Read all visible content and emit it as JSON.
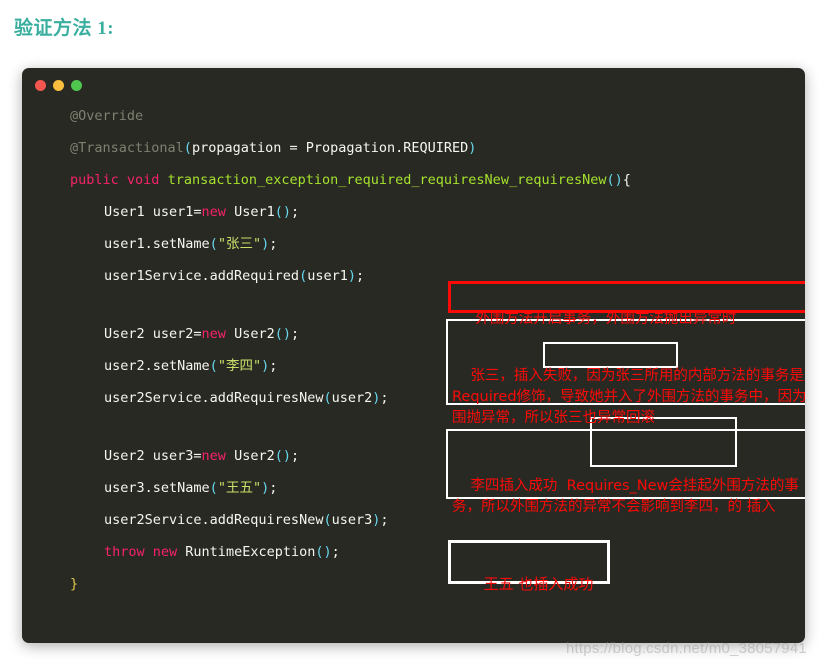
{
  "page": {
    "title": "验证方法 1:",
    "title_color": "#3aafa0",
    "background": "#ffffff"
  },
  "code_window": {
    "background": "#282923",
    "traffic_lights": [
      {
        "name": "close",
        "color": "#f4574f"
      },
      {
        "name": "minimize",
        "color": "#f9be3e"
      },
      {
        "name": "maximize",
        "color": "#4fc74f"
      }
    ],
    "lines": [
      {
        "indent": 0,
        "tokens": [
          {
            "t": "@Override",
            "c": "anno"
          }
        ]
      },
      {
        "indent": 0,
        "tokens": [
          {
            "t": "@Transactional",
            "c": "anno"
          },
          {
            "t": "(",
            "c": "punct"
          },
          {
            "t": "propagation",
            "c": "plain"
          },
          {
            "t": " = ",
            "c": "plain"
          },
          {
            "t": "Propagation.REQUIRED",
            "c": "plain"
          },
          {
            "t": ")",
            "c": "punct"
          }
        ]
      },
      {
        "indent": 0,
        "tokens": [
          {
            "t": "public",
            "c": "kw"
          },
          {
            "t": " ",
            "c": "plain"
          },
          {
            "t": "void",
            "c": "kw"
          },
          {
            "t": " ",
            "c": "plain"
          },
          {
            "t": "transaction_exception_required_requiresNew_requiresNew",
            "c": "fn"
          },
          {
            "t": "(",
            "c": "punct"
          },
          {
            "t": ")",
            "c": "punct"
          },
          {
            "t": "{",
            "c": "plain"
          }
        ]
      },
      {
        "indent": 1,
        "tokens": [
          {
            "t": "User1 user1=",
            "c": "plain"
          },
          {
            "t": "new",
            "c": "kw"
          },
          {
            "t": " User1",
            "c": "plain"
          },
          {
            "t": "(",
            "c": "punct"
          },
          {
            "t": ")",
            "c": "punct"
          },
          {
            "t": ";",
            "c": "plain"
          }
        ]
      },
      {
        "indent": 1,
        "tokens": [
          {
            "t": "user1.setName",
            "c": "plain"
          },
          {
            "t": "(",
            "c": "punct"
          },
          {
            "t": "\"张三\"",
            "c": "str"
          },
          {
            "t": ")",
            "c": "punct"
          },
          {
            "t": ";",
            "c": "plain"
          }
        ]
      },
      {
        "indent": 1,
        "tokens": [
          {
            "t": "user1Service.addRequired",
            "c": "plain"
          },
          {
            "t": "(",
            "c": "punct"
          },
          {
            "t": "user1",
            "c": "plain"
          },
          {
            "t": ")",
            "c": "punct"
          },
          {
            "t": ";",
            "c": "plain"
          }
        ]
      },
      {
        "indent": 1,
        "blank": true,
        "tokens": []
      },
      {
        "indent": 1,
        "tokens": [
          {
            "t": "User2 user2=",
            "c": "plain"
          },
          {
            "t": "new",
            "c": "kw"
          },
          {
            "t": " User2",
            "c": "plain"
          },
          {
            "t": "(",
            "c": "punct"
          },
          {
            "t": ")",
            "c": "punct"
          },
          {
            "t": ";",
            "c": "plain"
          }
        ]
      },
      {
        "indent": 1,
        "tokens": [
          {
            "t": "user2.setName",
            "c": "plain"
          },
          {
            "t": "(",
            "c": "punct"
          },
          {
            "t": "\"李四\"",
            "c": "str"
          },
          {
            "t": ")",
            "c": "punct"
          },
          {
            "t": ";",
            "c": "plain"
          }
        ]
      },
      {
        "indent": 1,
        "tokens": [
          {
            "t": "user2Service.addRequiresNew",
            "c": "plain"
          },
          {
            "t": "(",
            "c": "punct"
          },
          {
            "t": "user2",
            "c": "plain"
          },
          {
            "t": ")",
            "c": "punct"
          },
          {
            "t": ";",
            "c": "plain"
          }
        ]
      },
      {
        "indent": 1,
        "blank": true,
        "tokens": []
      },
      {
        "indent": 1,
        "tokens": [
          {
            "t": "User2 user3=",
            "c": "plain"
          },
          {
            "t": "new",
            "c": "kw"
          },
          {
            "t": " User2",
            "c": "plain"
          },
          {
            "t": "(",
            "c": "punct"
          },
          {
            "t": ")",
            "c": "punct"
          },
          {
            "t": ";",
            "c": "plain"
          }
        ]
      },
      {
        "indent": 1,
        "tokens": [
          {
            "t": "user3.setName",
            "c": "plain"
          },
          {
            "t": "(",
            "c": "punct"
          },
          {
            "t": "\"王五\"",
            "c": "str"
          },
          {
            "t": ")",
            "c": "punct"
          },
          {
            "t": ";",
            "c": "plain"
          }
        ]
      },
      {
        "indent": 1,
        "tokens": [
          {
            "t": "user2Service.addRequiresNew",
            "c": "plain"
          },
          {
            "t": "(",
            "c": "punct"
          },
          {
            "t": "user3",
            "c": "plain"
          },
          {
            "t": ")",
            "c": "punct"
          },
          {
            "t": ";",
            "c": "plain"
          }
        ]
      },
      {
        "indent": 1,
        "tokens": [
          {
            "t": "throw",
            "c": "kw"
          },
          {
            "t": " ",
            "c": "plain"
          },
          {
            "t": "new",
            "c": "kw"
          },
          {
            "t": " RuntimeException",
            "c": "plain"
          },
          {
            "t": "(",
            "c": "punct"
          },
          {
            "t": ")",
            "c": "punct"
          },
          {
            "t": ";",
            "c": "plain"
          }
        ]
      },
      {
        "indent": 0,
        "tokens": [
          {
            "t": "}",
            "c": "brace"
          }
        ]
      }
    ]
  },
  "annotations": {
    "outer_transaction": {
      "text": "外围方法开启事务，外围方法抛出异常时",
      "border_color": "#fb0a08",
      "text_color": "#fb0a08"
    },
    "zhangsan": {
      "text": "张三，插入失败，因为张三所用的内部方法的事务是用Required修饰，导致她并入了外围方法的事务中，因为外围抛异常，所以张三也异常回滚",
      "highlight": "Required修饰",
      "border_color": "#ffffff",
      "text_color": "#fb0a08"
    },
    "lisi": {
      "text": "李四插入成功  Requires_New会挂起外围方法的事务，所以外围方法的异常不会影响到李四，的 插入",
      "highlight": "Requires_New",
      "border_color": "#ffffff",
      "text_color": "#fb0a08"
    },
    "wangwu": {
      "text": "王五 也插入成功",
      "border_color": "#ffffff",
      "text_color": "#fb0a08"
    }
  },
  "watermark": {
    "text": "https://blog.csdn.net/m0_38057941"
  }
}
